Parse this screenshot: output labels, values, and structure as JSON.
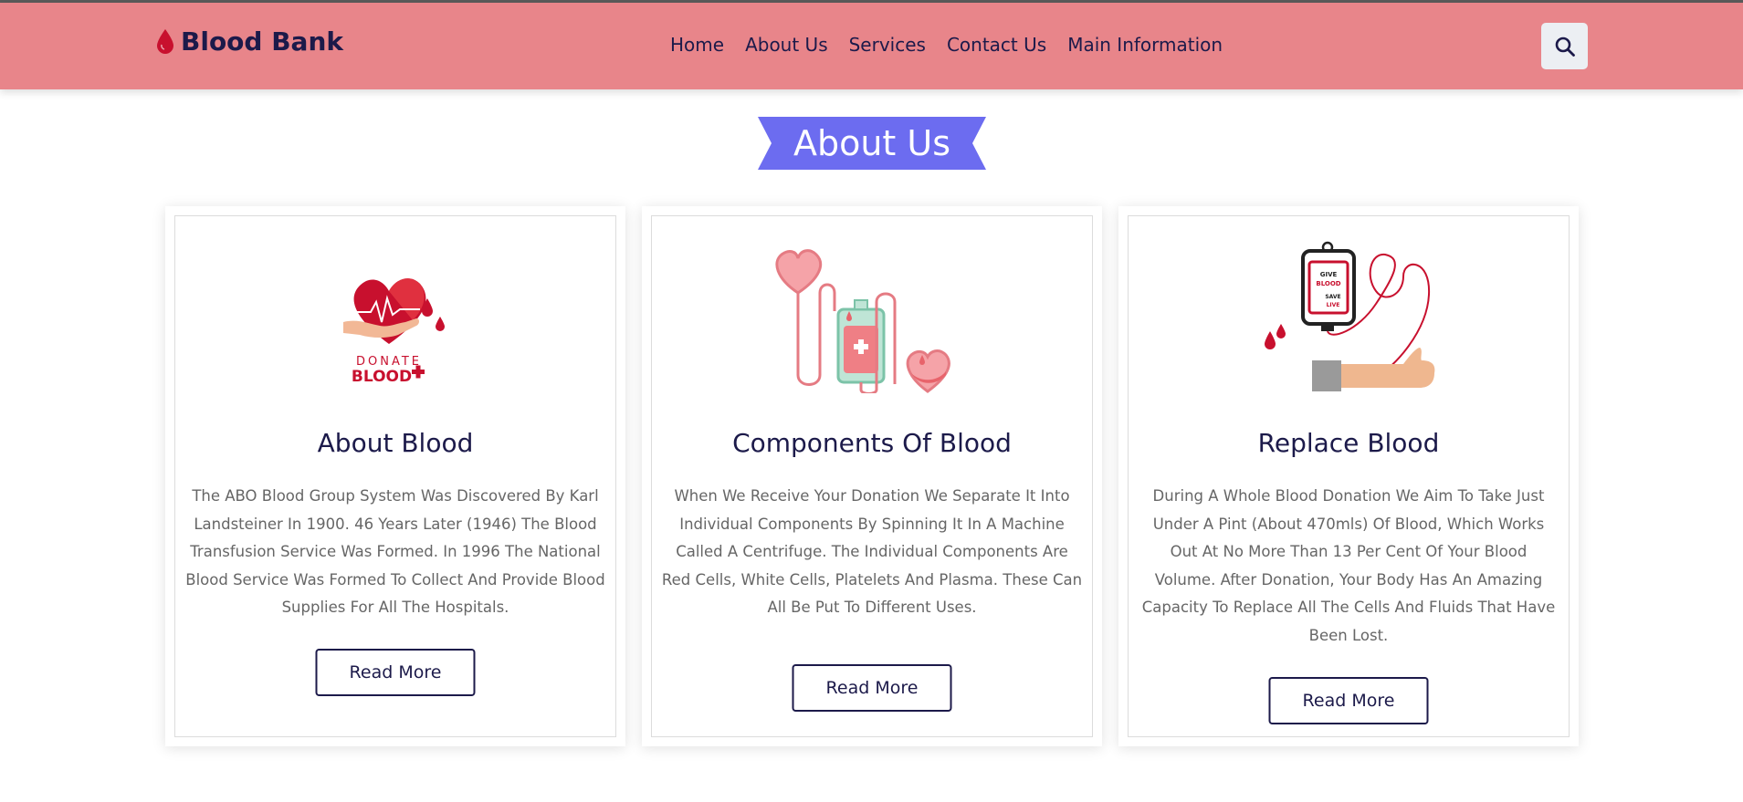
{
  "header": {
    "logo_text": "Blood Bank",
    "nav": [
      "Home",
      "About Us",
      "Services",
      "Contact Us",
      "Main Information"
    ]
  },
  "section": {
    "title": "About Us"
  },
  "cards": [
    {
      "title": "About Blood",
      "text": "The ABO Blood Group System Was Discovered By Karl Landsteiner In 1900. 46 Years Later (1946) The Blood Transfusion Service Was Formed. In 1996 The National Blood Service Was Formed To Collect And Provide Blood Supplies For All The Hospitals.",
      "button": "Read More",
      "image_label_1": "DONATE",
      "image_label_2": "BLOOD"
    },
    {
      "title": "Components Of Blood",
      "text": "When We Receive Your Donation We Separate It Into Individual Components By Spinning It In A Machine Called A Centrifuge. The Individual Components Are Red Cells, White Cells, Platelets And Plasma. These Can All Be Put To Different Uses.",
      "button": "Read More"
    },
    {
      "title": "Replace Blood",
      "text": "During A Whole Blood Donation We Aim To Take Just Under A Pint (About 470mls) Of Blood, Which Works Out At No More Than 13 Per Cent Of Your Blood Volume. After Donation, Your Body Has An Amazing Capacity To Replace All The Cells And Fluids That Have Been Lost.",
      "button": "Read More",
      "image_label_1": "GIVE",
      "image_label_2": "BLOOD",
      "image_label_3": "SAVE",
      "image_label_4": "LIVE"
    }
  ],
  "colors": {
    "header_bg": "#e8858a",
    "brand_text": "#1c1a4a",
    "ribbon": "#6c6cf0",
    "blood_red": "#c8102e"
  },
  "icons": {
    "logo": "blood-drop-icon",
    "search": "search-icon"
  }
}
